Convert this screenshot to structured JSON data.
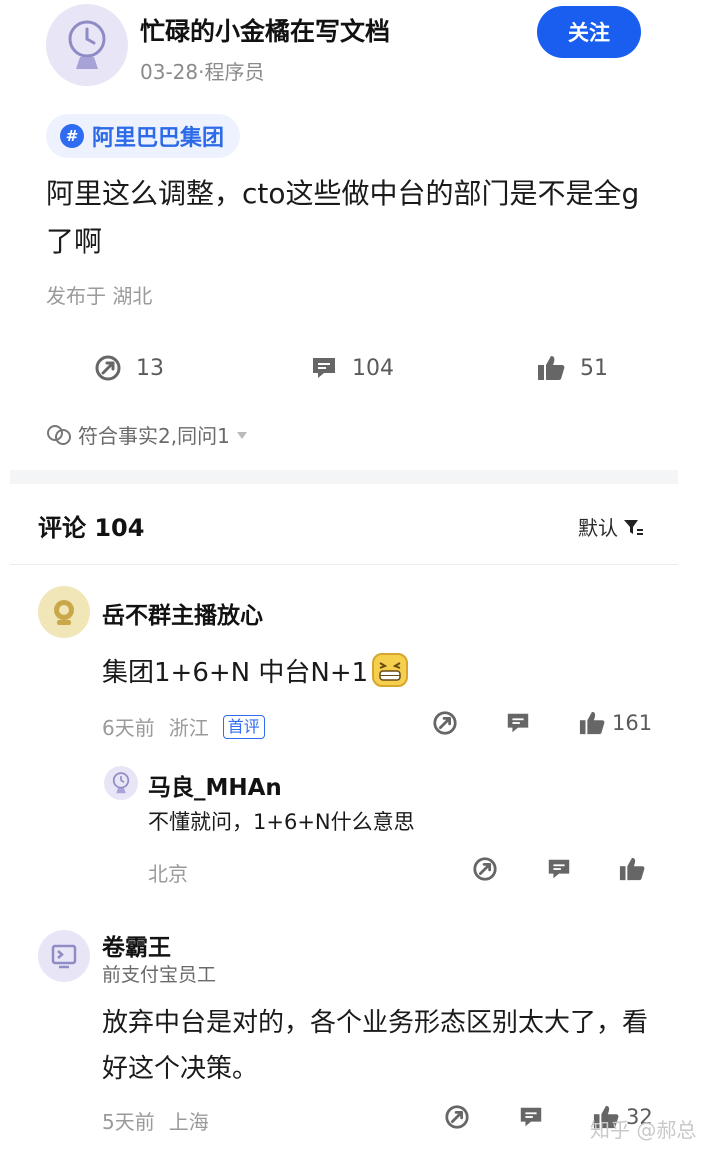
{
  "post": {
    "author_name": "忙碌的小金橘在写文档",
    "author_meta": "03-28·程序员",
    "follow_label": "关注",
    "topic_hash": "#",
    "topic": "阿里巴巴集团",
    "text": "阿里这么调整，cto这些做中台的部门是不是全g了啊",
    "location": "发布于 湖北",
    "stats": {
      "reposts": "13",
      "comments": "104",
      "likes": "51"
    },
    "reactions_text": "符合事实2,同问1"
  },
  "comments_section": {
    "title": "评论 104",
    "sort_label": "默认"
  },
  "comments": [
    {
      "author": "岳不群主播放心",
      "text": "集团1+6+N 中台N+1",
      "time": "6天前",
      "location": "浙江",
      "badge": "首评",
      "likes": "161"
    },
    {
      "author": "马良_MHAn",
      "text": "不懂就问，1+6+N什么意思",
      "location": "北京"
    },
    {
      "author": "卷霸王",
      "subtitle": "前支付宝员工",
      "text": "放弃中台是对的，各个业务形态区别太大了，看好这个决策。",
      "time": "5天前",
      "location": "上海",
      "likes": "32"
    }
  ],
  "watermark": "知乎 @郝总",
  "colors": {
    "accent": "#1a5ef0",
    "topic_bg": "#edf2fe",
    "muted": "#9a9a9a"
  }
}
